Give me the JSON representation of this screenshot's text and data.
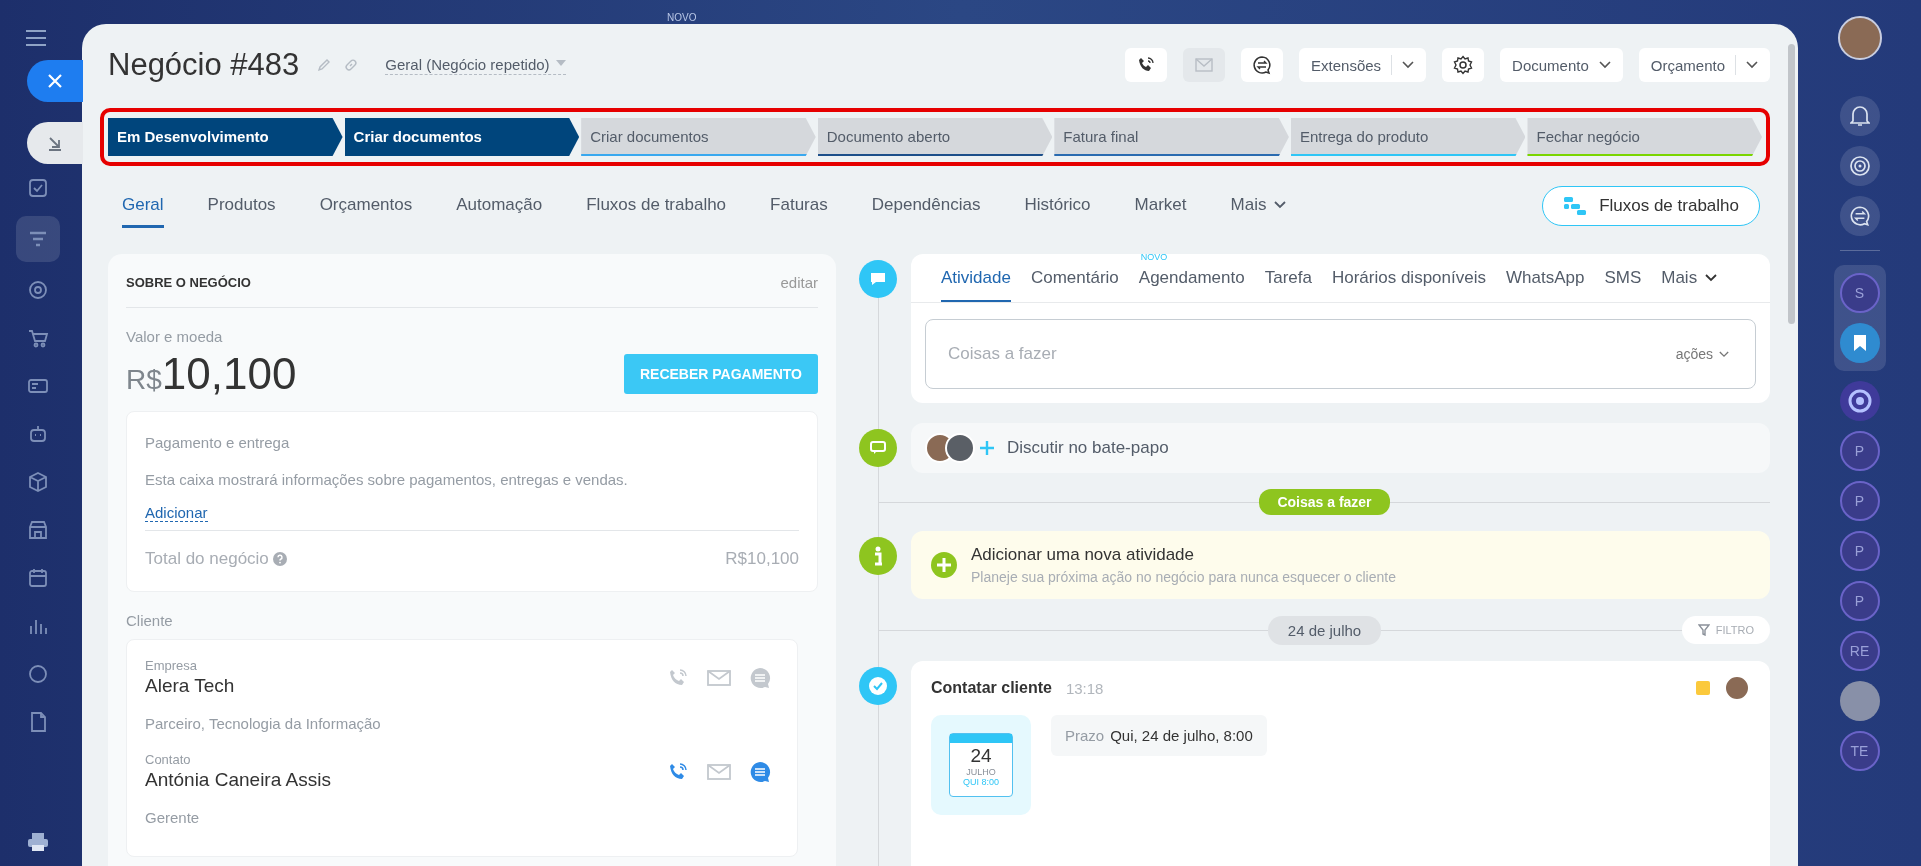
{
  "top_badge": "NOVO",
  "header": {
    "title": "Negócio #483",
    "pipeline": "Geral (Negócio repetido)",
    "contact_buttons": [
      {
        "disabled": false
      },
      {
        "disabled": true
      },
      {
        "disabled": false
      }
    ],
    "menus": [
      {
        "label": "Extensões",
        "split": true
      },
      {
        "label": "Documento",
        "split": false
      },
      {
        "label": "Orçamento",
        "split": true
      }
    ]
  },
  "stages": [
    {
      "label": "Em Desenvolvimento",
      "selected": true,
      "color": "#00457c"
    },
    {
      "label": "Criar documentos",
      "selected": true,
      "color": "#00457c"
    },
    {
      "label": "Criar documentos",
      "selected": false,
      "color": "#39a8ef"
    },
    {
      "label": "Documento aberto",
      "selected": false,
      "color": "#1d4f8a"
    },
    {
      "label": "Fatura final",
      "selected": false,
      "color": "#2a6bb0"
    },
    {
      "label": "Entrega do produto",
      "selected": false,
      "color": "#2fc6f6"
    },
    {
      "label": "Fechar negócio",
      "selected": false,
      "color": "#7bd500"
    }
  ],
  "tabs": [
    {
      "label": "Geral",
      "selected": true,
      "dropdown": false
    },
    {
      "label": "Produtos",
      "selected": false,
      "dropdown": false
    },
    {
      "label": "Orçamentos",
      "selected": false,
      "dropdown": false
    },
    {
      "label": "Automação",
      "selected": false,
      "dropdown": false
    },
    {
      "label": "Fluxos de trabalho",
      "selected": false,
      "dropdown": false
    },
    {
      "label": "Faturas",
      "selected": false,
      "dropdown": false
    },
    {
      "label": "Dependências",
      "selected": false,
      "dropdown": false
    },
    {
      "label": "Histórico",
      "selected": false,
      "dropdown": false
    },
    {
      "label": "Market",
      "selected": false,
      "dropdown": false
    },
    {
      "label": "Mais",
      "selected": false,
      "dropdown": true
    }
  ],
  "workflow_button": "Fluxos de trabalho",
  "about": {
    "title": "SOBRE O NEGÓCIO",
    "edit": "editar",
    "amount_label": "Valor e moeda",
    "currency": "R$",
    "amount": "10,100",
    "pay_button": "RECEBER PAGAMENTO",
    "payment": {
      "title": "Pagamento e entrega",
      "text": "Esta caixa mostrará informações sobre pagamentos, entregas e vendas.",
      "add_link": "Adicionar",
      "total_label": "Total do negócio",
      "total": "R$10,100"
    },
    "client_label": "Cliente",
    "clients": [
      {
        "role": "Empresa",
        "name": "Alera Tech",
        "detail": "Parceiro, Tecnologia da Informação",
        "phone": false,
        "email": false,
        "chat": false
      },
      {
        "role": "Contato",
        "name": "Antónia Caneira Assis",
        "detail": "Gerente",
        "phone": true,
        "email": false,
        "chat": true
      }
    ]
  },
  "activity": {
    "tabs": [
      {
        "label": "Atividade",
        "selected": true,
        "dropdown": false
      },
      {
        "label": "Comentário",
        "selected": false,
        "dropdown": false
      },
      {
        "label": "Agendamento",
        "selected": false,
        "dropdown": false,
        "badge": "NOVO"
      },
      {
        "label": "Tarefa",
        "selected": false,
        "dropdown": false
      },
      {
        "label": "Horários disponíveis",
        "selected": false,
        "dropdown": false
      },
      {
        "label": "WhatsApp",
        "selected": false,
        "dropdown": false
      },
      {
        "label": "SMS",
        "selected": false,
        "dropdown": false
      },
      {
        "label": "Mais",
        "selected": false,
        "dropdown": true
      }
    ],
    "placeholder": "Coisas a fazer",
    "actions": "ações"
  },
  "chat": {
    "label": "Discutir no bate-papo"
  },
  "todo_divider": "Coisas a fazer",
  "new_activity": {
    "title": "Adicionar uma nova atividade",
    "subtitle": "Planeje sua próxima ação no negócio para nunca esquecer o cliente"
  },
  "date_divider": "24 de julho",
  "filter_button": "FILTRO",
  "task": {
    "title": "Contatar cliente",
    "time": "13:18",
    "calendar": {
      "day": "24",
      "month": "JULHO",
      "weekday_time": "QUI 8:00"
    },
    "deadline_label": "Prazo",
    "deadline": "Qui, 24 de julho, 8:00"
  },
  "right_rail": {
    "pinned": [
      {
        "initials": "S"
      }
    ],
    "chats": [
      {
        "kind": "initials",
        "initials": "P"
      },
      {
        "kind": "initials",
        "initials": "P"
      },
      {
        "kind": "initials",
        "initials": "P"
      },
      {
        "kind": "initials",
        "initials": "P"
      },
      {
        "kind": "initials",
        "initials": "RE"
      },
      {
        "kind": "photo"
      },
      {
        "kind": "initials",
        "initials": "TE"
      }
    ]
  }
}
